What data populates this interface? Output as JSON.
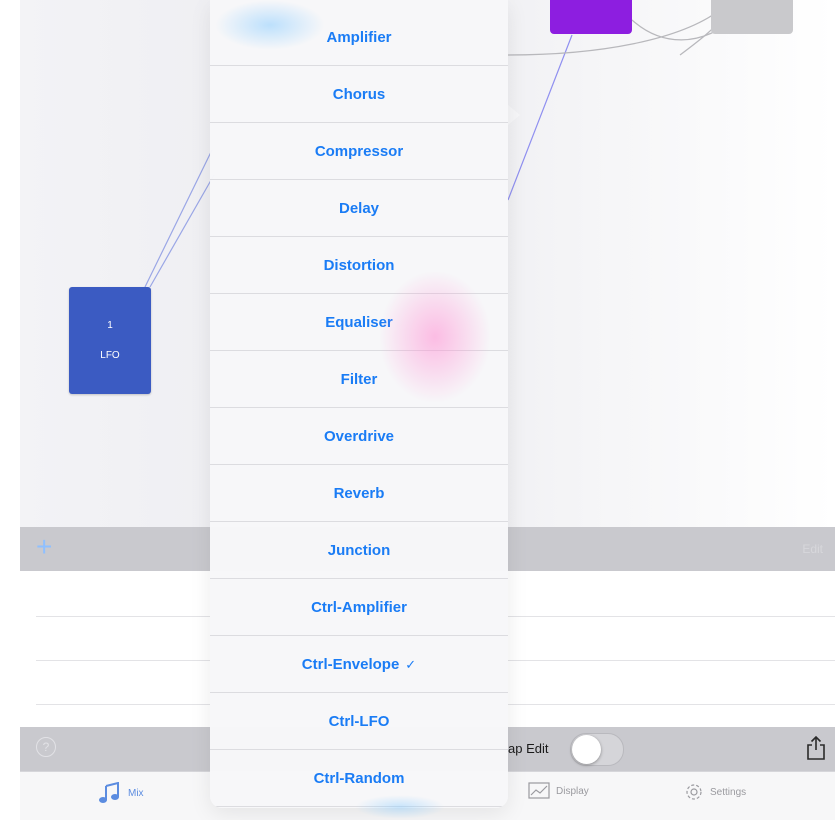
{
  "modules": {
    "lfo": {
      "number": "1",
      "label": "LFO",
      "color": "#3b5bc2"
    },
    "purple_color": "#8d1ee0",
    "gray_color": "#c9c9cc"
  },
  "track_header": {
    "add_label": "+",
    "edit_label": "Edit"
  },
  "bottom_bar": {
    "help_label": "?",
    "map_edit_label": "ap Edit",
    "map_edit_on": false
  },
  "tabs": [
    {
      "label": "Mix",
      "icon": "music-note-icon",
      "active": true
    },
    {
      "label": "Display",
      "icon": "display-icon",
      "active": false
    },
    {
      "label": "Settings",
      "icon": "gear-icon",
      "active": false
    }
  ],
  "menu": {
    "accent_color": "#1a7cf5",
    "items": [
      {
        "label": "Amplifier",
        "checked": false
      },
      {
        "label": "Chorus",
        "checked": false
      },
      {
        "label": "Compressor",
        "checked": false
      },
      {
        "label": "Delay",
        "checked": false
      },
      {
        "label": "Distortion",
        "checked": false
      },
      {
        "label": "Equaliser",
        "checked": false
      },
      {
        "label": "Filter",
        "checked": false
      },
      {
        "label": "Overdrive",
        "checked": false
      },
      {
        "label": "Reverb",
        "checked": false
      },
      {
        "label": "Junction",
        "checked": false
      },
      {
        "label": "Ctrl-Amplifier",
        "checked": false
      },
      {
        "label": "Ctrl-Envelope",
        "checked": true,
        "check_mark": "✓"
      },
      {
        "label": "Ctrl-LFO",
        "checked": false
      },
      {
        "label": "Ctrl-Random",
        "checked": false
      }
    ]
  }
}
